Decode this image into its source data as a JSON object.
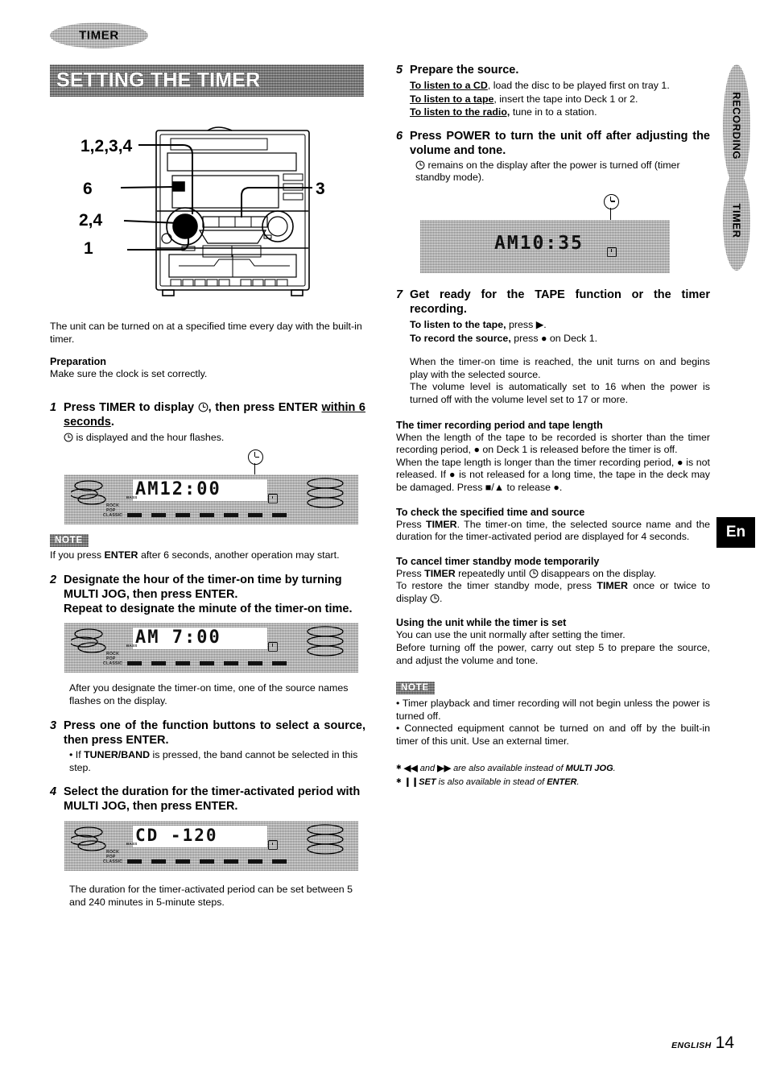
{
  "tab": {
    "label": "TIMER"
  },
  "banner": {
    "title": "SETTING THE TIMER"
  },
  "side_tabs": [
    {
      "label": "RECORDING"
    },
    {
      "label": "TIMER"
    }
  ],
  "lang_badge": {
    "label": "En"
  },
  "footer": {
    "language": "ENGLISH",
    "page": "14"
  },
  "diagram": {
    "callouts": [
      {
        "label": "1,2,3,4"
      },
      {
        "label": "6"
      },
      {
        "label": "2,4"
      },
      {
        "label": "1"
      },
      {
        "label": "3"
      }
    ]
  },
  "left": {
    "intro": "The unit can be turned on at a specified time every day with the built-in timer.",
    "preparation_heading": "Preparation",
    "preparation_text": "Make sure the clock is set correctly.",
    "step1": {
      "num": "1",
      "head_a": "Press TIMER to display ",
      "head_b": ", then press ENTER ",
      "head_c": "within 6 seconds",
      "head_d": ".",
      "sub_a": " is displayed and the hour flashes."
    },
    "display1": {
      "text": "AM12:00",
      "eq": [
        "ROCK",
        "POP",
        "CLASSIC"
      ],
      "bass_label": "BASS"
    },
    "note1": {
      "chip": "NOTE",
      "text_a": "If you press ",
      "text_b": "ENTER",
      "text_c": " after 6 seconds, another operation may start."
    },
    "step2": {
      "num": "2",
      "head": "Designate the hour of the timer-on time by turning MULTI JOG, then press ENTER.",
      "head2": "Repeat to designate the minute of the timer-on time."
    },
    "display2": {
      "text": "AM 7:00",
      "eq": [
        "ROCK",
        "POP",
        "CLASSIC"
      ],
      "bass_label": "BASS"
    },
    "after_step2": "After you designate the timer-on time, one of the source names flashes on the display.",
    "step3": {
      "num": "3",
      "head": "Press one of the function buttons to select a source, then press ENTER.",
      "bullet_a": "• If ",
      "bullet_b": "TUNER/BAND",
      "bullet_c": " is pressed, the band cannot be selected in this step."
    },
    "step4": {
      "num": "4",
      "head": "Select the duration for the timer-activated period with MULTI JOG, then press ENTER."
    },
    "display4": {
      "text": "CD    -120",
      "eq": [
        "ROCK",
        "POP",
        "CLASSIC"
      ],
      "bass_label": "BASS"
    },
    "after_step4": "The duration for the timer-activated period can be set between 5 and 240 minutes in 5-minute steps."
  },
  "right": {
    "step5": {
      "num": "5",
      "head": "Prepare the source.",
      "lines": [
        {
          "lead": "To listen to a CD",
          "rest": ", load the disc to be played first on tray 1."
        },
        {
          "lead": "To listen to a tape",
          "rest": ", insert the tape into Deck 1 or 2."
        },
        {
          "lead": "To listen to the radio,",
          "rest": " tune in to a station."
        }
      ]
    },
    "step6": {
      "num": "6",
      "head": "Press POWER to turn the unit off after adjusting the volume and tone.",
      "sub": " remains on the display after the power is turned off (timer standby mode)."
    },
    "display6": {
      "text": "AM10:35"
    },
    "step7": {
      "num": "7",
      "head": "Get ready for the TAPE function or the timer recording.",
      "line1_lead": "To listen to the tape,",
      "line1_rest": " press ",
      "line1_tail": ".",
      "line2_lead": "To record the source,",
      "line2_rest": " press ",
      "line2_tail": " on Deck 1.",
      "para1": "When the timer-on time is reached, the unit turns on and begins play with the selected source.",
      "para2": "The volume level is automatically set to 16 when the power is turned off with the volume level set to 17 or more."
    },
    "sect_tape": {
      "heading": "The timer recording period and tape length",
      "p1_a": "When the length of the tape to be recorded is shorter than the timer recording period, ",
      "p1_b": " on Deck 1 is released before the timer is off.",
      "p2_a": "When the tape length is longer than the timer recording period, ",
      "p2_b": " is not released.  If ",
      "p2_c": " is not released for a long time, the tape in the deck may be damaged.  Press ",
      "p2_d": " to release ",
      "p2_e": "."
    },
    "sect_check": {
      "heading": "To check the specified time and source",
      "text_a": "Press ",
      "text_b": "TIMER",
      "text_c": ". The timer-on time, the selected source name and the duration for the timer-activated period are displayed for 4 seconds."
    },
    "sect_cancel": {
      "heading": "To cancel timer standby mode temporarily",
      "l1_a": "Press ",
      "l1_b": "TIMER",
      "l1_c": " repeatedly until ",
      "l1_d": " disappears on the display.",
      "l2_a": "To restore the timer standby mode, press ",
      "l2_b": "TIMER",
      "l2_c": " once or twice to display ",
      "l2_d": "."
    },
    "sect_using": {
      "heading": "Using the unit while the timer is set",
      "p1": "You can use the unit normally after setting the timer.",
      "p2": "Before turning off the power, carry out step 5 to prepare the source, and adjust the volume and tone."
    },
    "note2": {
      "chip": "NOTE",
      "b1": "• Timer playback and timer recording will not begin unless the power is turned off.",
      "b2": "• Connected equipment cannot be turned on and off by the built-in timer of this unit.  Use an external timer."
    },
    "footnotes": {
      "f1_a": " and ",
      "f1_b": " are also available instead of ",
      "f1_c": "MULTI JOG",
      "f1_d": ".",
      "f2_a": "SET",
      "f2_b": " is also available in stead of ",
      "f2_c": "ENTER",
      "f2_d": "."
    }
  },
  "icons": {
    "clock": "clock-icon",
    "play": "play-icon",
    "record": "record-icon",
    "stop_eject": "stop-eject-icon",
    "pause": "pause-icon",
    "rew": "rewind-icon",
    "ffwd": "fast-forward-icon"
  }
}
